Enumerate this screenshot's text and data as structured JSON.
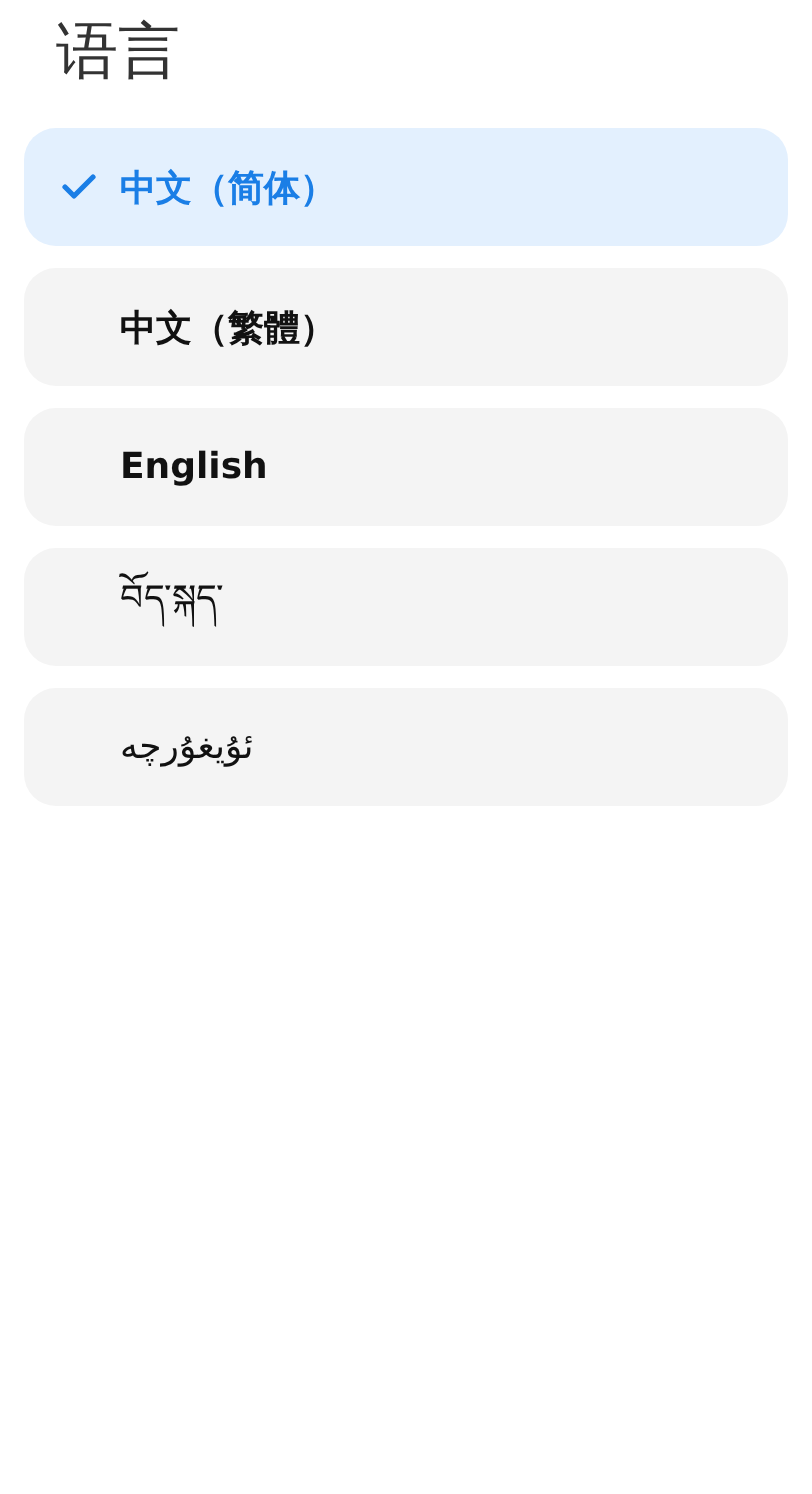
{
  "title": "语言",
  "languages": [
    {
      "label": "中文（简体）",
      "selected": true
    },
    {
      "label": "中文（繁體）",
      "selected": false
    },
    {
      "label": "English",
      "selected": false
    },
    {
      "label": "བོད་སྐད་",
      "selected": false
    },
    {
      "label": "ئۇيغۇرچە",
      "selected": false
    }
  ]
}
